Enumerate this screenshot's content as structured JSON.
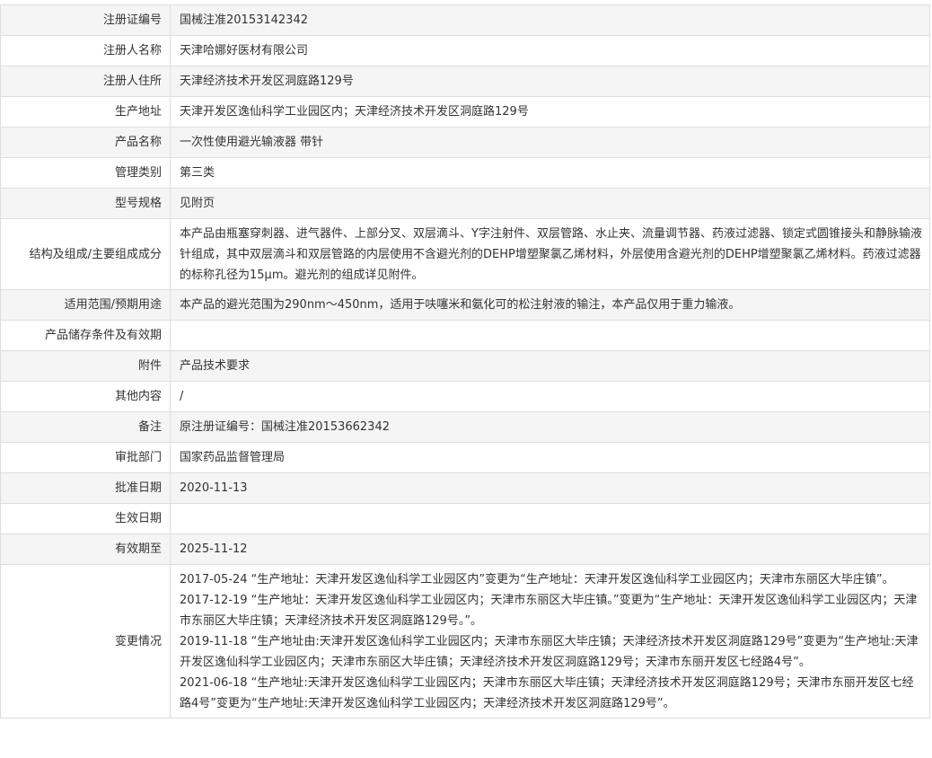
{
  "rows": [
    {
      "label": "注册证编号",
      "value": "国械注准20153142342"
    },
    {
      "label": "注册人名称",
      "value": "天津哈娜好医材有限公司"
    },
    {
      "label": "注册人住所",
      "value": "天津经济技术开发区洞庭路129号"
    },
    {
      "label": "生产地址",
      "value": "天津开发区逸仙科学工业园区内；天津经济技术开发区洞庭路129号"
    },
    {
      "label": "产品名称",
      "value": "一次性使用避光输液器 带针"
    },
    {
      "label": "管理类别",
      "value": "第三类"
    },
    {
      "label": "型号规格",
      "value": "见附页"
    },
    {
      "label": "结构及组成/主要组成成分",
      "value": "本产品由瓶塞穿刺器、进气器件、上部分叉、双层滴斗、Y字注射件、双层管路、水止夹、流量调节器、药液过滤器、锁定式圆锥接头和静脉输液针组成，其中双层滴斗和双层管路的内层使用不含避光剂的DEHP增塑聚氯乙烯材料，外层使用含避光剂的DEHP增塑聚氯乙烯材料。药液过滤器的标称孔径为15μm。避光剂的组成详见附件。"
    },
    {
      "label": "适用范围/预期用途",
      "value": "本产品的避光范围为290nm～450nm，适用于呋噻米和氨化可的松注射液的输注，本产品仅用于重力输液。"
    },
    {
      "label": "产品储存条件及有效期",
      "value": ""
    },
    {
      "label": "附件",
      "value": "产品技术要求"
    },
    {
      "label": "其他内容",
      "value": "/"
    },
    {
      "label": "备注",
      "value": "原注册证编号：国械注准20153662342"
    },
    {
      "label": "审批部门",
      "value": "国家药品监督管理局"
    },
    {
      "label": "批准日期",
      "value": "2020-11-13"
    },
    {
      "label": "生效日期",
      "value": ""
    },
    {
      "label": "有效期至",
      "value": "2025-11-12"
    }
  ],
  "changes": {
    "label": "变更情况",
    "entries": [
      "2017-05-24 “生产地址：天津开发区逸仙科学工业园区内”变更为“生产地址：天津开发区逸仙科学工业园区内；天津市东丽区大毕庄镇”。",
      "2017-12-19 “生产地址：天津开发区逸仙科学工业园区内；天津市东丽区大毕庄镇。”变更为“生产地址：天津开发区逸仙科学工业园区内；天津市东丽区大毕庄镇；天津经济技术开发区洞庭路129号。”。",
      "2019-11-18 “生产地址由:天津开发区逸仙科学工业园区内；天津市东丽区大毕庄镇；天津经济技术开发区洞庭路129号”变更为“生产地址:天津开发区逸仙科学工业园区内；天津市东丽区大毕庄镇；天津经济技术开发区洞庭路129号；天津市东丽开发区七经路4号”。",
      "2021-06-18 “生产地址:天津开发区逸仙科学工业园区内；天津市东丽区大毕庄镇；天津经济技术开发区洞庭路129号；天津市东丽开发区七经路4号”变更为“生产地址:天津开发区逸仙科学工业园区内；天津经济技术开发区洞庭路129号”。"
    ]
  }
}
